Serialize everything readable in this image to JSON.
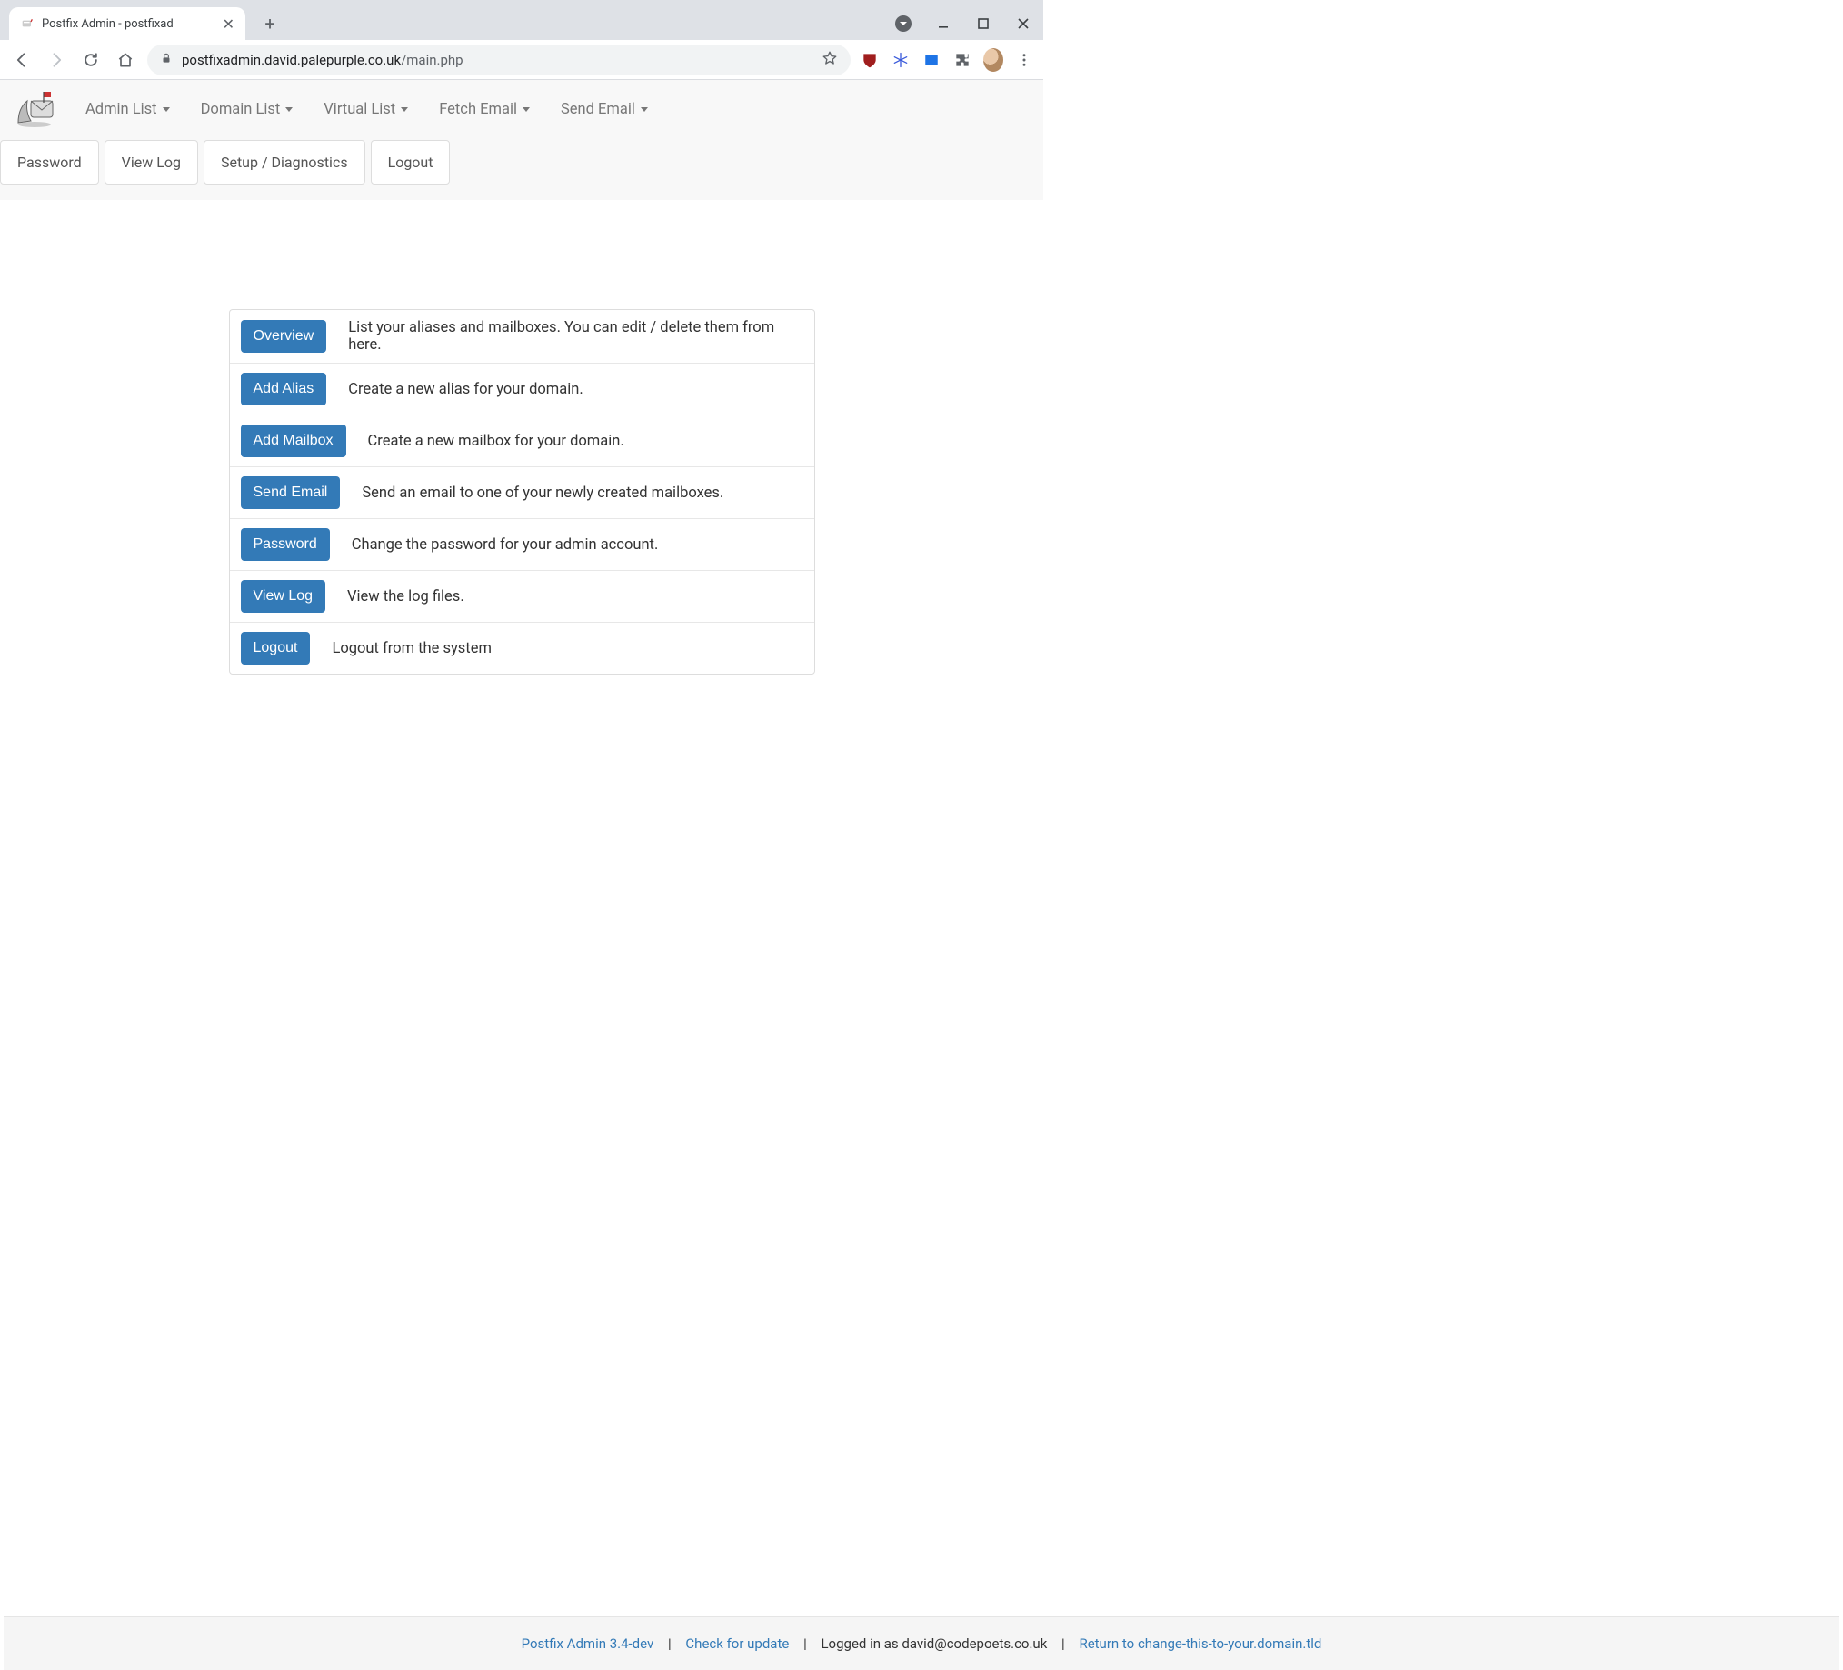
{
  "chrome": {
    "tab_title": "Postfix Admin - postfixad",
    "url_host": "postfixadmin.david.palepurple.co.uk",
    "url_path": "/main.php"
  },
  "nav": {
    "menu": [
      "Admin List",
      "Domain List",
      "Virtual List",
      "Fetch Email",
      "Send Email"
    ],
    "right_tabs": [
      "Password",
      "View Log",
      "Setup / Diagnostics",
      "Logout"
    ]
  },
  "main": {
    "rows": [
      {
        "button": "Overview",
        "desc": "List your aliases and mailboxes. You can edit / delete them from here."
      },
      {
        "button": "Add Alias",
        "desc": "Create a new alias for your domain."
      },
      {
        "button": "Add Mailbox",
        "desc": "Create a new mailbox for your domain."
      },
      {
        "button": "Send Email",
        "desc": "Send an email to one of your newly created mailboxes."
      },
      {
        "button": "Password",
        "desc": "Change the password for your admin account."
      },
      {
        "button": "View Log",
        "desc": "View the log files."
      },
      {
        "button": "Logout",
        "desc": "Logout from the system"
      }
    ]
  },
  "footer": {
    "version_link": "Postfix Admin 3.4-dev",
    "check_update": "Check for update",
    "logged_in_prefix": "Logged in as ",
    "logged_in_user": "david@codepoets.co.uk",
    "return_link": "Return to change-this-to-your.domain.tld",
    "sep": "|"
  }
}
